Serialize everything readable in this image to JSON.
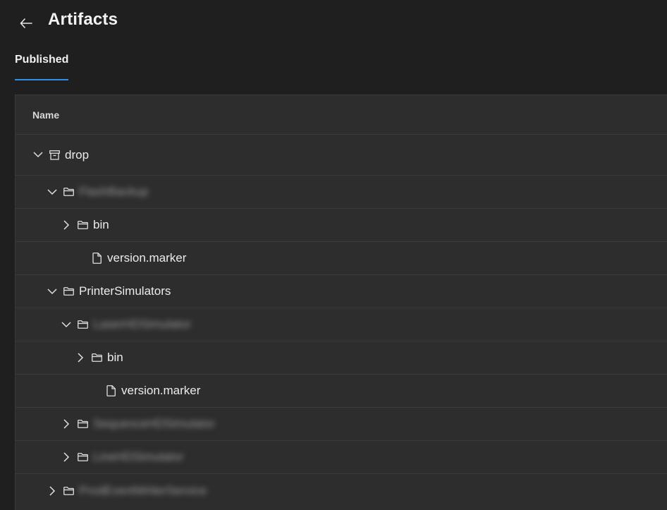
{
  "header": {
    "title": "Artifacts"
  },
  "tabs": [
    {
      "label": "Published"
    }
  ],
  "table": {
    "column_name": "Name",
    "rows": [
      {
        "label": "drop",
        "icon": "archive-icon",
        "expanded": true
      },
      {
        "label": "FlashBackup",
        "icon": "folder-icon",
        "expanded": true
      },
      {
        "label": "bin",
        "icon": "folder-icon",
        "expanded": false
      },
      {
        "label": "version.marker",
        "icon": "file-icon"
      },
      {
        "label": "PrinterSimulators",
        "icon": "folder-icon",
        "expanded": true
      },
      {
        "label": "LaserHDSimulator",
        "icon": "folder-icon",
        "expanded": true
      },
      {
        "label": "bin",
        "icon": "folder-icon",
        "expanded": false
      },
      {
        "label": "version.marker",
        "icon": "file-icon"
      },
      {
        "label": "SequenceHDSimulator",
        "icon": "folder-icon",
        "expanded": false
      },
      {
        "label": "LineHDSimulator",
        "icon": "folder-icon",
        "expanded": false
      },
      {
        "label": "ProdEventWriterService",
        "icon": "folder-icon",
        "expanded": false
      }
    ]
  },
  "colors": {
    "background": "#1f1f1f",
    "panel": "#2d2d2d",
    "accent": "#2f8ee6"
  }
}
